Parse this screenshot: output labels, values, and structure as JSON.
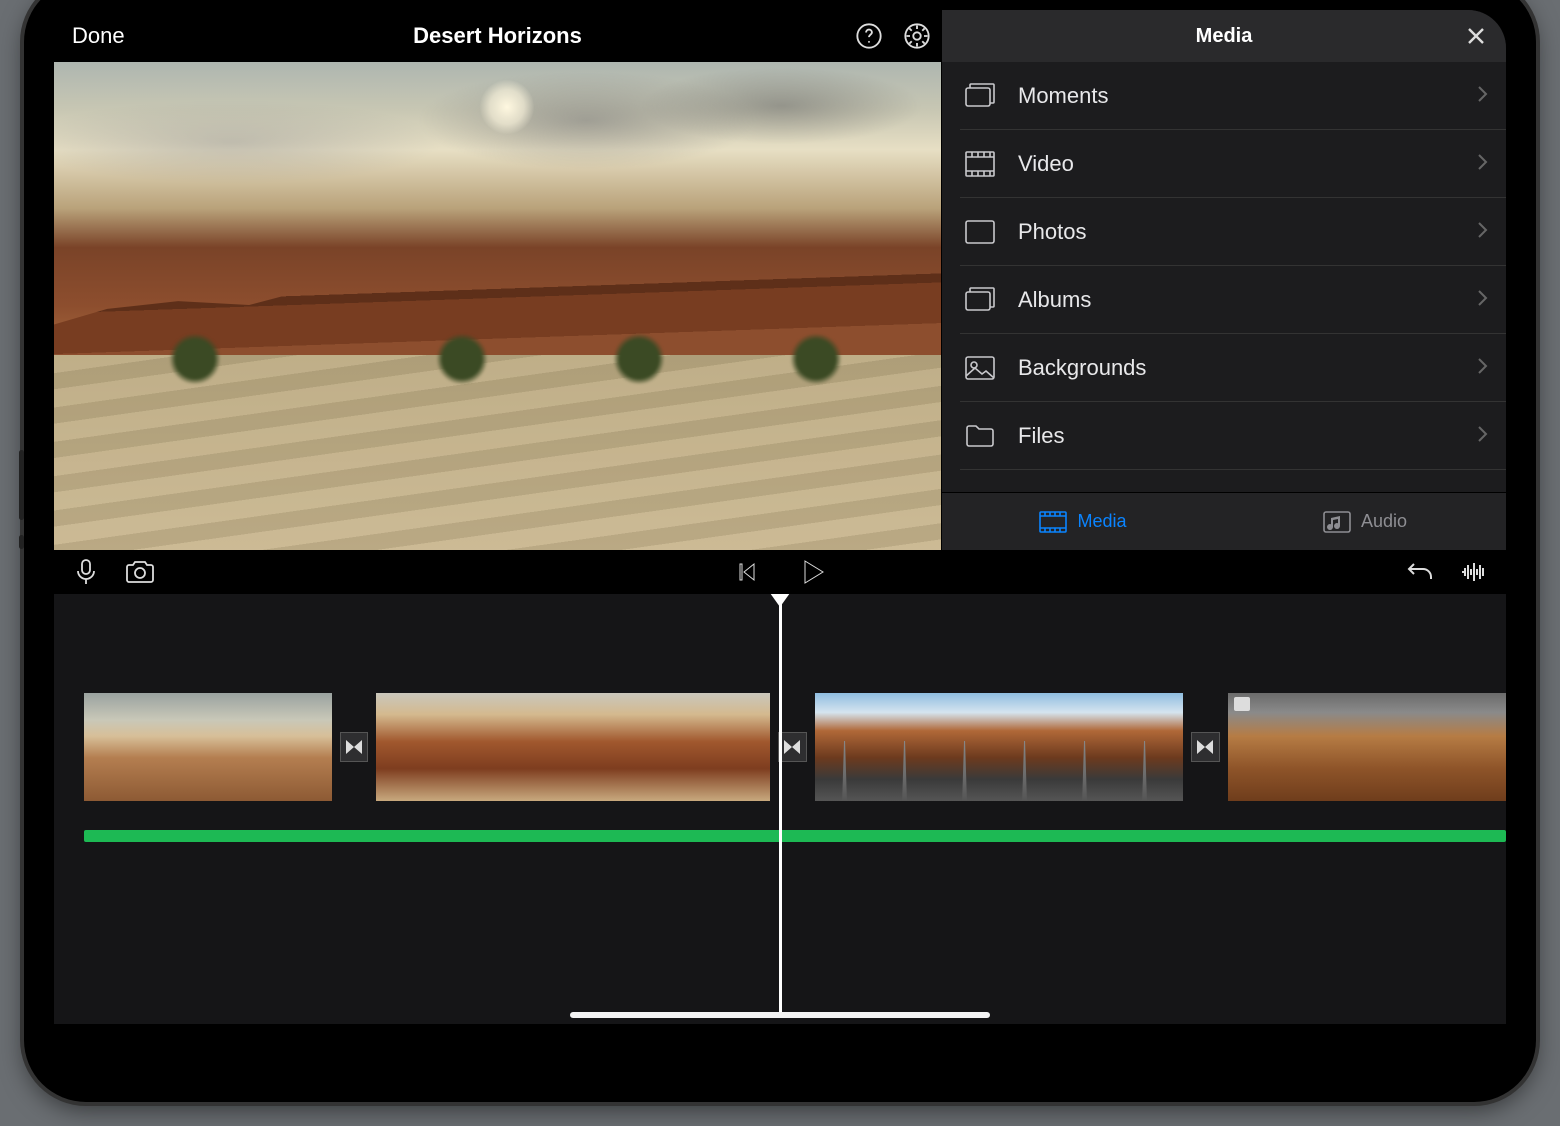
{
  "header": {
    "done_label": "Done",
    "project_title": "Desert Horizons"
  },
  "media_panel": {
    "title": "Media",
    "items": [
      {
        "label": "Moments",
        "icon": "moments-icon"
      },
      {
        "label": "Video",
        "icon": "filmstrip-icon"
      },
      {
        "label": "Photos",
        "icon": "photo-icon"
      },
      {
        "label": "Albums",
        "icon": "albums-icon"
      },
      {
        "label": "Backgrounds",
        "icon": "image-icon"
      },
      {
        "label": "Files",
        "icon": "folder-icon"
      }
    ],
    "tabs": {
      "media_label": "Media",
      "audio_label": "Audio",
      "active": "media"
    }
  },
  "transport": {
    "icons": [
      "microphone-icon",
      "camera-icon",
      "skip-back-icon",
      "play-icon",
      "undo-icon",
      "waveform-icon"
    ]
  },
  "timeline": {
    "playhead_percent": 50,
    "audio_color": "#1db954",
    "clips": [
      {
        "id": "clip-1",
        "frames": 4,
        "style": "th-sky",
        "has_marker": false
      },
      {
        "id": "clip-2",
        "frames": 6,
        "style": "th-red",
        "has_marker": false
      },
      {
        "id": "clip-3",
        "frames": 6,
        "style": "th-road",
        "has_marker": false
      },
      {
        "id": "clip-4",
        "frames": 5,
        "style": "th-dune",
        "has_marker": true
      }
    ],
    "transition_icon": "transition-icon"
  }
}
